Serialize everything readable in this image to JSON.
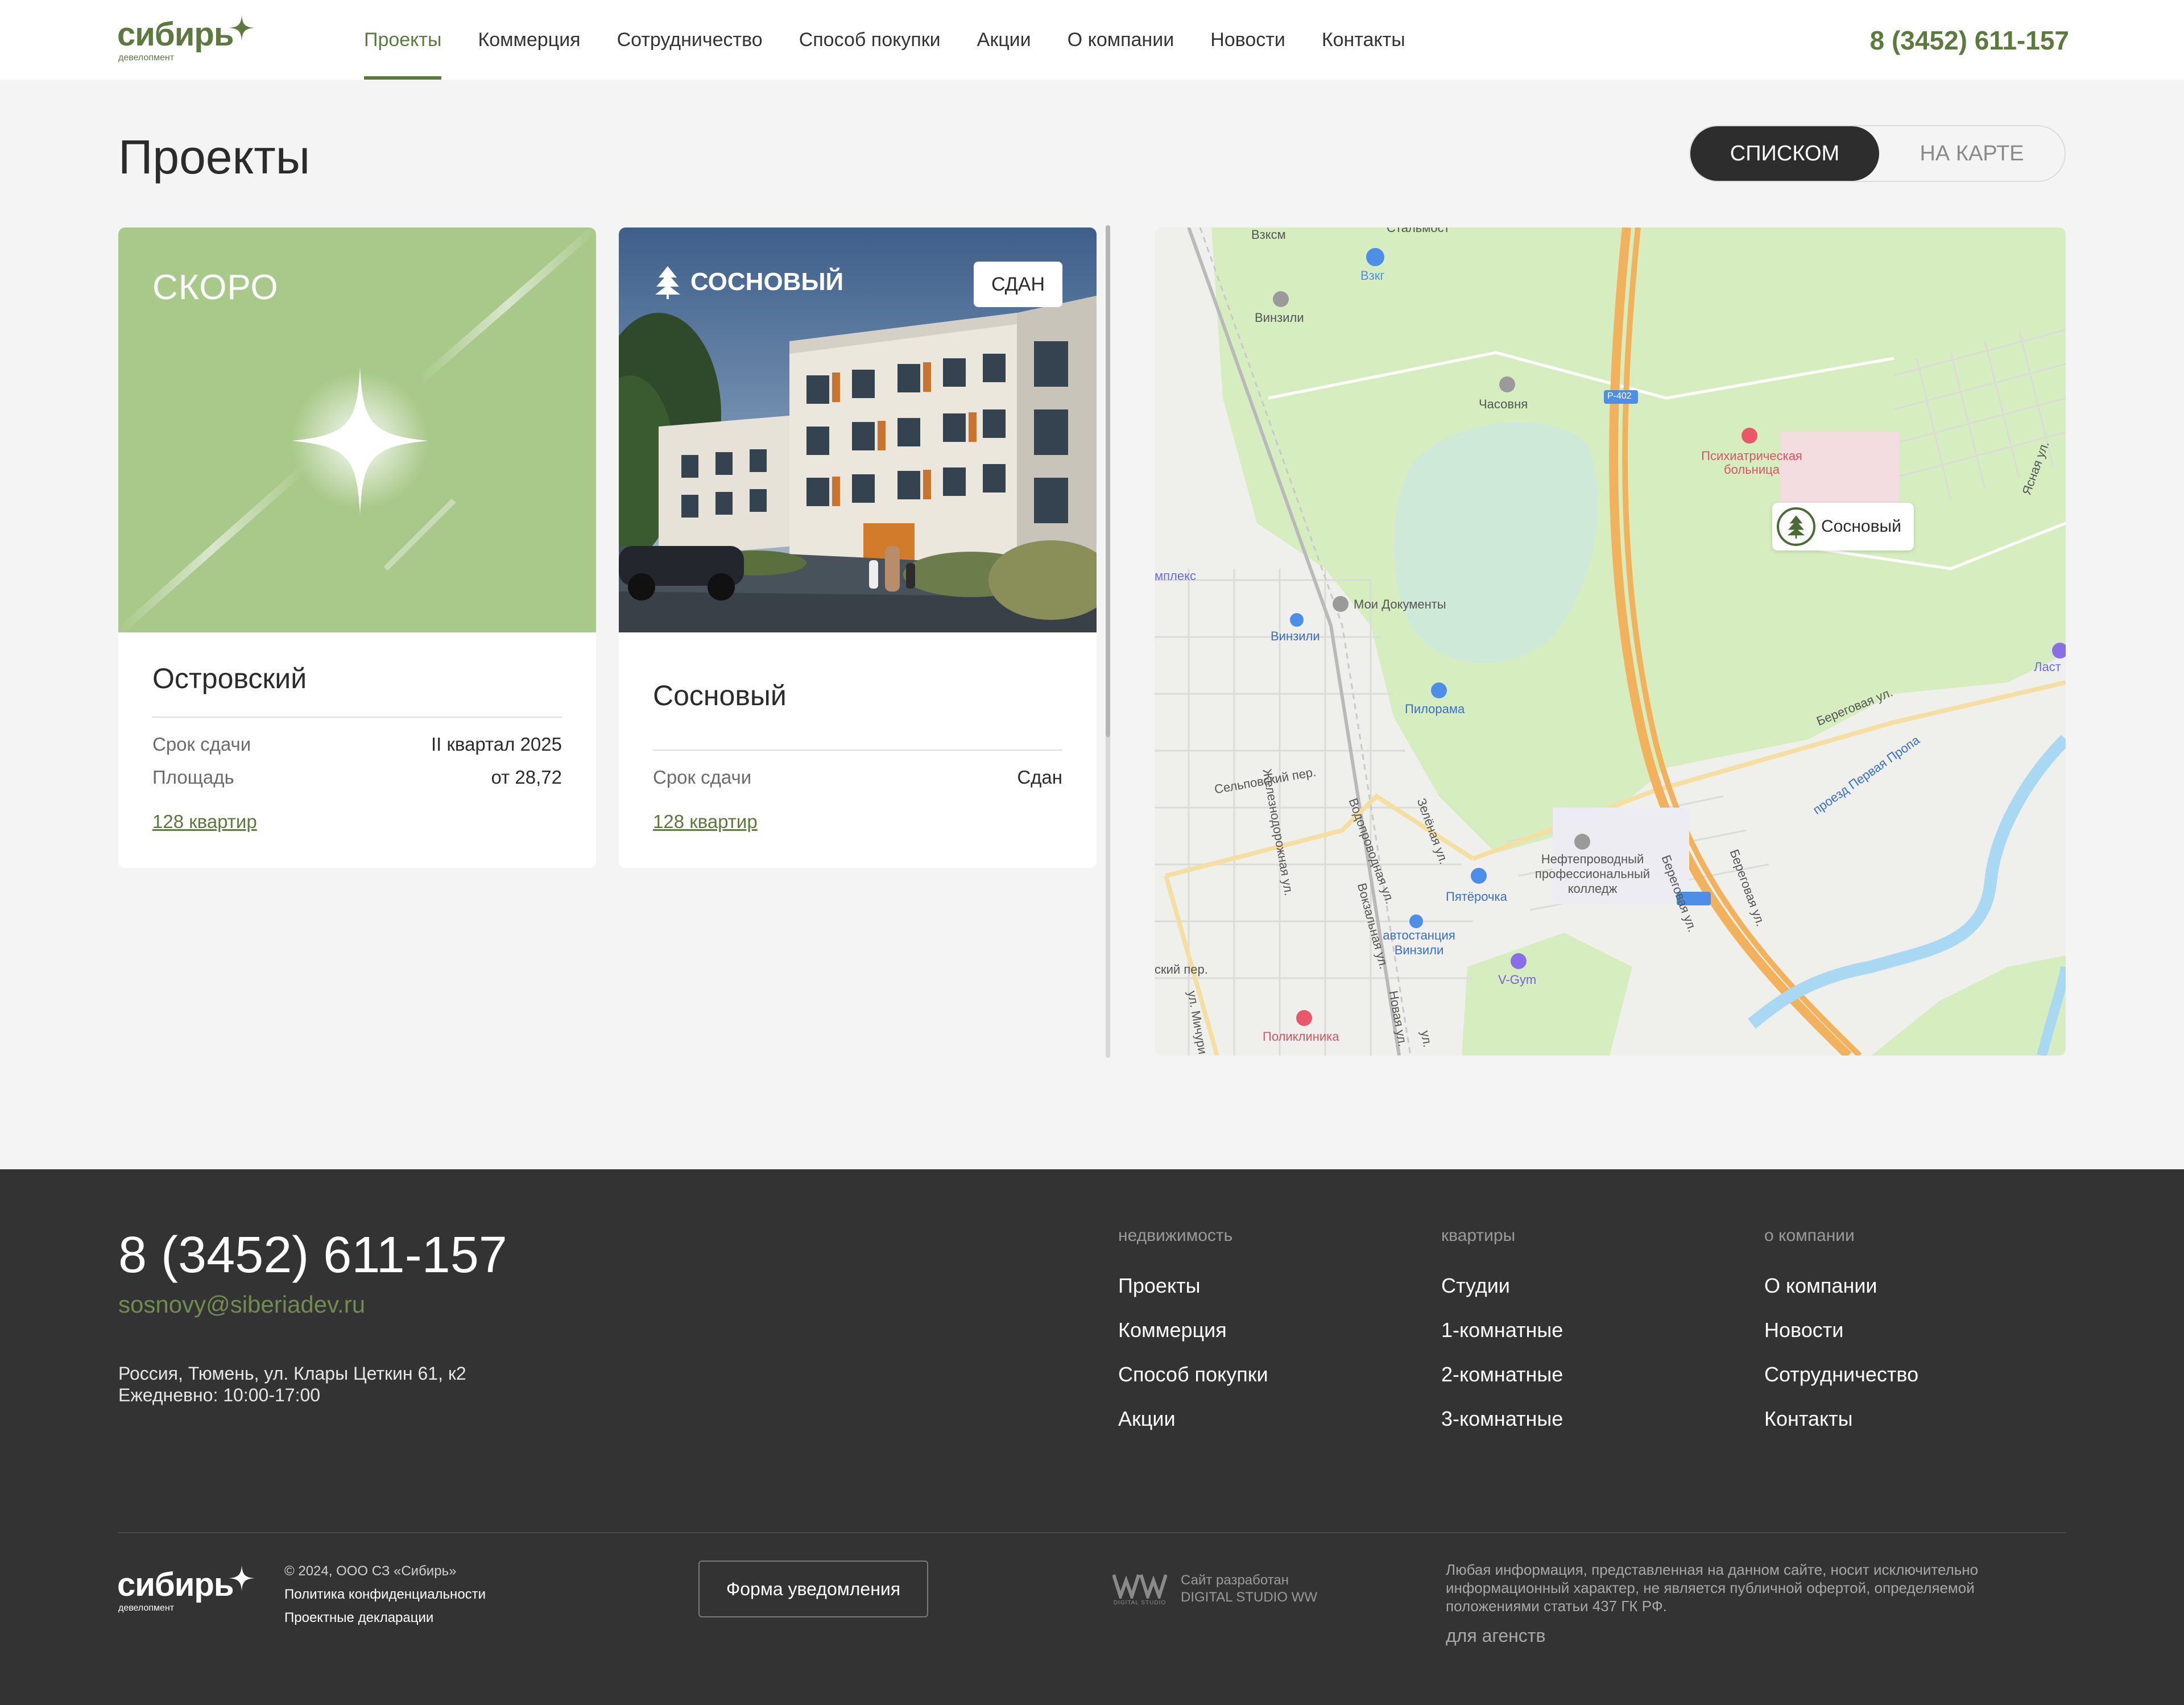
{
  "header": {
    "logo_word": "сибирь",
    "logo_sub": "девелопмент",
    "nav": [
      "Проекты",
      "Коммерция",
      "Сотрудничество",
      "Способ покупки",
      "Акции",
      "О компании",
      "Новости",
      "Контакты"
    ],
    "active_nav": "Проекты",
    "phone": "8 (3452) 611-157"
  },
  "page": {
    "title": "Проекты",
    "toggle_list": "СПИСКОМ",
    "toggle_map": "НА КАРТЕ",
    "active_view": "СПИСКОМ"
  },
  "cards": [
    {
      "badge": "СКОРО",
      "name": "Островский",
      "rows": [
        {
          "label": "Срок сдачи",
          "value": "II квартал 2025"
        },
        {
          "label": "Площадь",
          "value": "от 28,72"
        }
      ],
      "link": "128 квартир"
    },
    {
      "brand": "СОСНОВЫЙ",
      "status": "СДАН",
      "name": "Сосновый",
      "rows": [
        {
          "label": "Срок сдачи",
          "value": "Сдан"
        }
      ],
      "link": "128 квартир"
    }
  ],
  "map": {
    "pin_label": "Сосновый",
    "labels": {
      "vzksm": "Взксм",
      "stalmost": "Стальмост",
      "vzkg": "Взкг",
      "vinzili_top": "Винзили",
      "chasovnya": "Часовня",
      "road_r402": "Р-402",
      "hospital": "Психиатрическая больница",
      "yasnaya": "Ясная ул.",
      "complex": "мплекс",
      "my_docs": "Мои Документы",
      "vinzili_station": "Винзили",
      "pilorama": "Пилорама",
      "beregovaya": "Береговая ул.",
      "last": "Ласт",
      "selpovsky": "Сельповский пер.",
      "zheleznodorozhnaya": "Железнодорожная ул.",
      "vodoprovodnaya": "Водопроводная ул.",
      "zelenaya": "Зелёная ул.",
      "vokzalnaya": "Вокзальная ул.",
      "beregovaya2": "Береговая ул.",
      "beregovaya3": "Береговая ул.",
      "proezd": "проезд Первая Пропа",
      "college": "Нефтепроводный профессиональный колледж",
      "pyaterochka": "Пятёрочка",
      "avtostanciya": "автостанция Винзили",
      "vgym": "V-Gym",
      "lesnoy": "ский пер.",
      "michurina": "ул. Мичури",
      "novaya": "Новая ул.",
      "poliklinika": "Поликлиника",
      "ul": "ул."
    },
    "colors": {
      "forest": "#d6eebf",
      "lake": "#cfe9d9",
      "river": "#a8d8f2",
      "highway": "#f2b25c",
      "road_minor": "#f5dfa0",
      "base": "#efefec"
    }
  },
  "footer": {
    "phone": "8 (3452) 611-157",
    "email": "sosnovy@siberiadev.ru",
    "address": "Россия, Тюмень, ул. Клары Цеткин 61, к2",
    "hours": "Ежедневно: 10:00-17:00",
    "columns": [
      {
        "title": "недвижимость",
        "items": [
          "Проекты",
          "Коммерция",
          "Способ покупки",
          "Акции"
        ]
      },
      {
        "title": "квартиры",
        "items": [
          "Студии",
          "1-комнатные",
          "2-комнатные",
          "3-комнатные"
        ]
      },
      {
        "title": "о компании",
        "items": [
          "О компании",
          "Новости",
          "Сотрудничество",
          "Контакты"
        ]
      }
    ],
    "copyright": "© 2024, ООО СЗ «Сибирь»",
    "privacy": "Политика конфиденциальности",
    "declarations": "Проектные декларации",
    "notify_button": "Форма уведомления",
    "studio_line1": "Сайт разработан",
    "studio_line2": "DIGITAL STUDIO WW",
    "studio_logo_caption": "DIGITAL STUDIO",
    "legal": "Любая информация, представленная на данном сайте, носит исключительно информационный характер, не является публичной офертой, определяемой положениями статьи 437 ГК РФ.",
    "agencies": "для агенств"
  }
}
